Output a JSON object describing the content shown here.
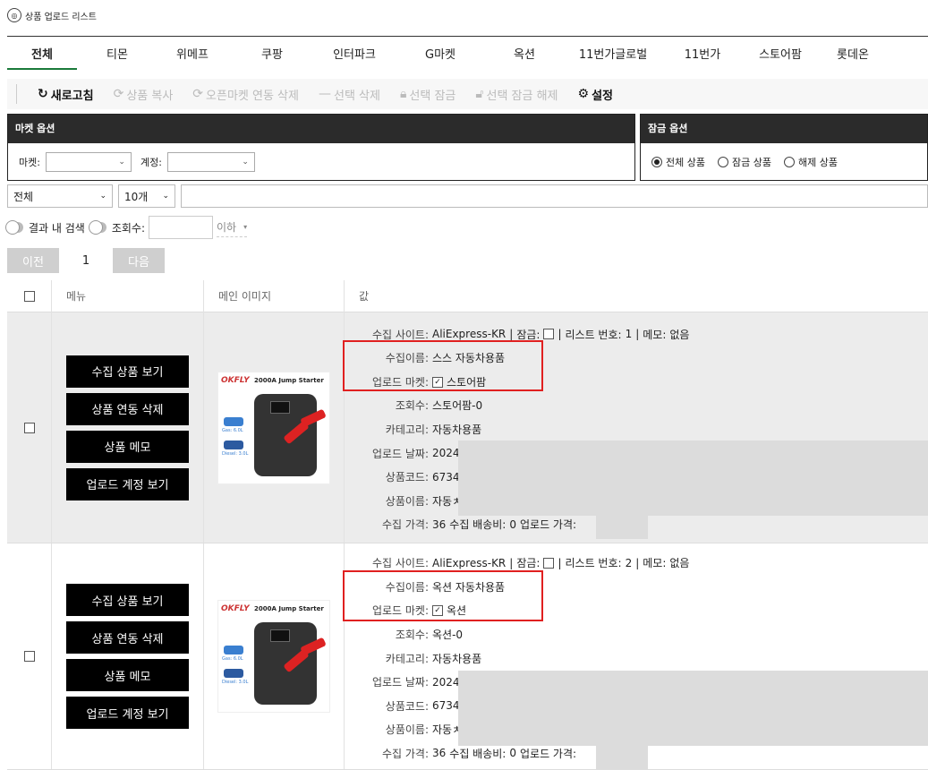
{
  "window": {
    "title": "상품 업로드 리스트"
  },
  "tabs": [
    "전체",
    "티몬",
    "위메프",
    "쿠팡",
    "인터파크",
    "G마켓",
    "옥션",
    "11번가글로벌",
    "11번가",
    "스토어팜",
    "롯데온"
  ],
  "toolbar": {
    "refresh": "새로고침",
    "copy": "상품 복사",
    "open_market_delete": "오픈마켓 연동 삭제",
    "delete_selected": "선택 삭제",
    "lock_selected": "선택 잠금",
    "unlock_selected": "선택 잠금 해제",
    "settings": "설정"
  },
  "market_options": {
    "title": "마켓 옵션",
    "market_label": "마켓:",
    "account_label": "계정:"
  },
  "lock_options": {
    "title": "잠금 옵션",
    "radios": [
      "전체 상품",
      "잠금 상품",
      "해제 상품"
    ],
    "selected_index": 0
  },
  "filter": {
    "scope_value": "전체",
    "page_size_value": "10개"
  },
  "search": {
    "within_results": "결과 내 검색",
    "views_label": "조회수:",
    "lte": "이하"
  },
  "pager": {
    "prev": "이전",
    "page": "1",
    "next": "다음"
  },
  "table": {
    "headers": {
      "menu": "메뉴",
      "image": "메인 이미지",
      "value": "값"
    },
    "menu_buttons": [
      "수집 상품 보기",
      "상품 연동 삭제",
      "상품 메모",
      "업로드 계정 보기"
    ],
    "labels": {
      "site": "수집 사이트:",
      "lock": "잠금:",
      "list_no": "리스트 번호:",
      "memo": "메모:",
      "collect_name": "수집이름:",
      "upload_market": "업로드 마켓:",
      "views": "조회수:",
      "category": "카테고리:",
      "upload_date": "업로드 날짜:",
      "product_code": "상품코드:",
      "product_name": "상품이름:",
      "collect_price": "수집 가격:",
      "shipping": "수집 배송비:",
      "upload_price": "업로드 가격:"
    },
    "product_image": {
      "brand": "OKFLY",
      "title": "2000A Jump Starter",
      "cap1": "Gas: 6.0L",
      "cap2": "Diesel: 3.0L"
    },
    "rows": [
      {
        "site": "AliExpress-KR",
        "list_no": "1",
        "memo": "없음",
        "collect_name": "스스 자동차용품",
        "upload_market": "스토어팜",
        "views": "스토어팜-0",
        "category": "자동차용품",
        "upload_date": "2024-",
        "product_code": "67342",
        "product_name": "자동ㅊ",
        "collect_price": "36",
        "shipping": "0"
      },
      {
        "site": "AliExpress-KR",
        "list_no": "2",
        "memo": "없음",
        "collect_name": "옥션 자동차용품",
        "upload_market": "옥션",
        "views": "옥션-0",
        "category": "자동차용품",
        "upload_date": "2024-",
        "product_code": "67342",
        "product_name": "자동ㅊ",
        "collect_price": "36",
        "shipping": "0"
      }
    ]
  },
  "colors": {
    "active_tab": "#1a7a3a",
    "highlight": "#e02020",
    "panel_header": "#2b2b2b"
  },
  "icons": [
    "refresh-icon",
    "copy-icon",
    "sync-icon",
    "minus-icon",
    "lock-icon",
    "unlock-icon",
    "gear-icon"
  ]
}
